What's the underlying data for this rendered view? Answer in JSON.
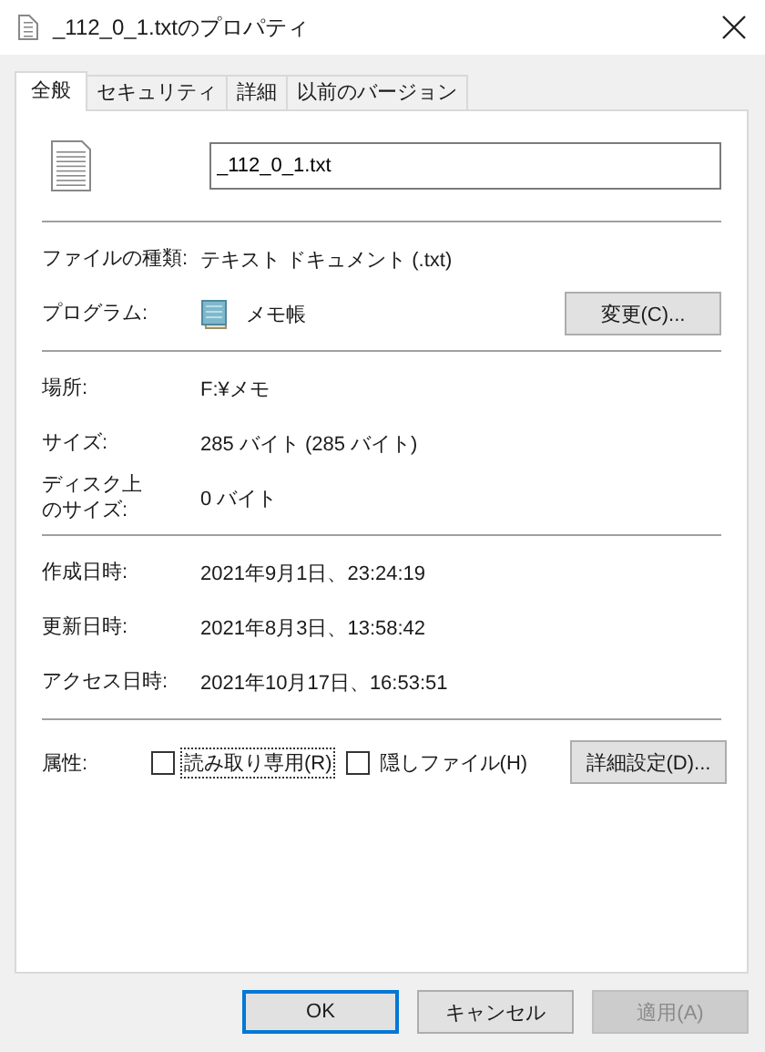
{
  "window": {
    "title": "_112_0_1.txtのプロパティ"
  },
  "tabs": [
    {
      "label": "全般",
      "selected": true
    },
    {
      "label": "セキュリティ",
      "selected": false
    },
    {
      "label": "詳細",
      "selected": false
    },
    {
      "label": "以前のバージョン",
      "selected": false
    }
  ],
  "file_name": {
    "value": "_112_0_1.txt"
  },
  "sections": [
    [
      {
        "label": "ファイルの種類:",
        "value": "テキスト ドキュメント (.txt)"
      },
      {
        "label": "プログラム:",
        "value": "メモ帳",
        "app_icon": true,
        "button": "変更(C)..."
      }
    ],
    [
      {
        "label": "場所:",
        "value": "F:¥メモ"
      },
      {
        "label": "サイズ:",
        "value": "285 バイト (285 バイト)"
      },
      {
        "label_lines": [
          "ディスク上",
          "のサイズ:"
        ],
        "value": "0 バイト"
      }
    ],
    [
      {
        "label": "作成日時:",
        "value": "2021年9月1日、23:24:19"
      },
      {
        "label": "更新日時:",
        "value": "2021年8月3日、13:58:42"
      },
      {
        "label": "アクセス日時:",
        "value": "2021年10月17日、16:53:51"
      }
    ]
  ],
  "attributes": {
    "label": "属性:",
    "checkboxes": [
      {
        "label": "読み取り専用(R)",
        "checked": false,
        "focused": true
      },
      {
        "label": "隠しファイル(H)",
        "checked": false,
        "focused": false
      }
    ],
    "button": "詳細設定(D)..."
  },
  "buttons": [
    {
      "label": "OK",
      "default": true,
      "disabled": false
    },
    {
      "label": "キャンセル",
      "default": false,
      "disabled": false
    },
    {
      "label": "適用(A)",
      "default": false,
      "disabled": true
    }
  ]
}
